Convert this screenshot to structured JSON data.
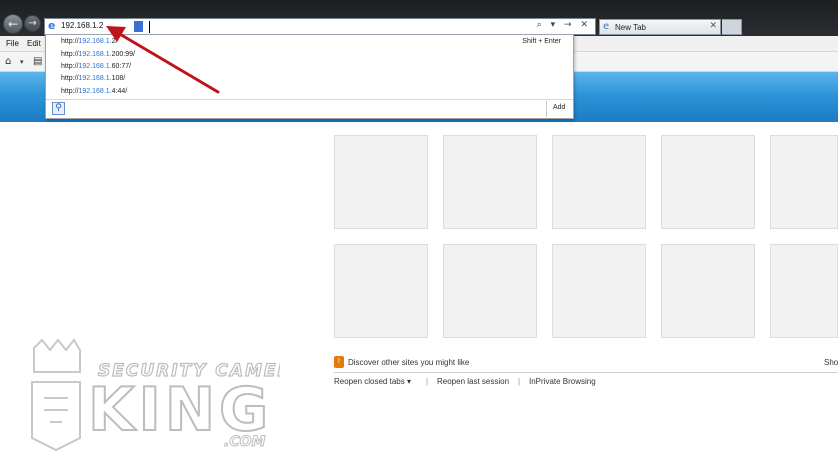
{
  "browser": {
    "address_value": "192.168.1.2",
    "address_tools": "⌕ ▾ → ✕",
    "tab_label": "New Tab",
    "tab_close": "✕"
  },
  "menu": {
    "file": "File",
    "edit": "Edit"
  },
  "suggestions": {
    "items": [
      {
        "prefix": "http://",
        "host": "192.168.1.",
        "suffix": "2/"
      },
      {
        "prefix": "http://",
        "host": "192.168.1.",
        "suffix": "200:99/"
      },
      {
        "prefix": "http://",
        "host": "192.168.1.",
        "suffix": "60:77/"
      },
      {
        "prefix": "http://",
        "host": "192.168.1.",
        "suffix": "108/"
      },
      {
        "prefix": "http://",
        "host": "192.168.1.",
        "suffix": "4:44/"
      }
    ],
    "hint": "Shift + Enter",
    "add_label": "Add"
  },
  "newtab": {
    "discover_text": "Discover other sites you might like",
    "show_text": "Sho",
    "reopen_closed": "Reopen closed tabs ▾",
    "reopen_last": "Reopen last session",
    "inprivate": "InPrivate Browsing",
    "separator": "|"
  },
  "watermark": {
    "line1": "SECURITY CAMERA",
    "line2": "KING",
    "line3": ".COM"
  },
  "colors": {
    "accent_blue": "#2e94d8",
    "arrow_red": "#c0141c",
    "highlight_link": "#2f6fd0"
  },
  "icons": {
    "back": "back-arrow-icon",
    "forward": "forward-arrow-icon",
    "ie": "ie-logo-icon",
    "search": "search-icon",
    "discover": "discover-icon"
  }
}
